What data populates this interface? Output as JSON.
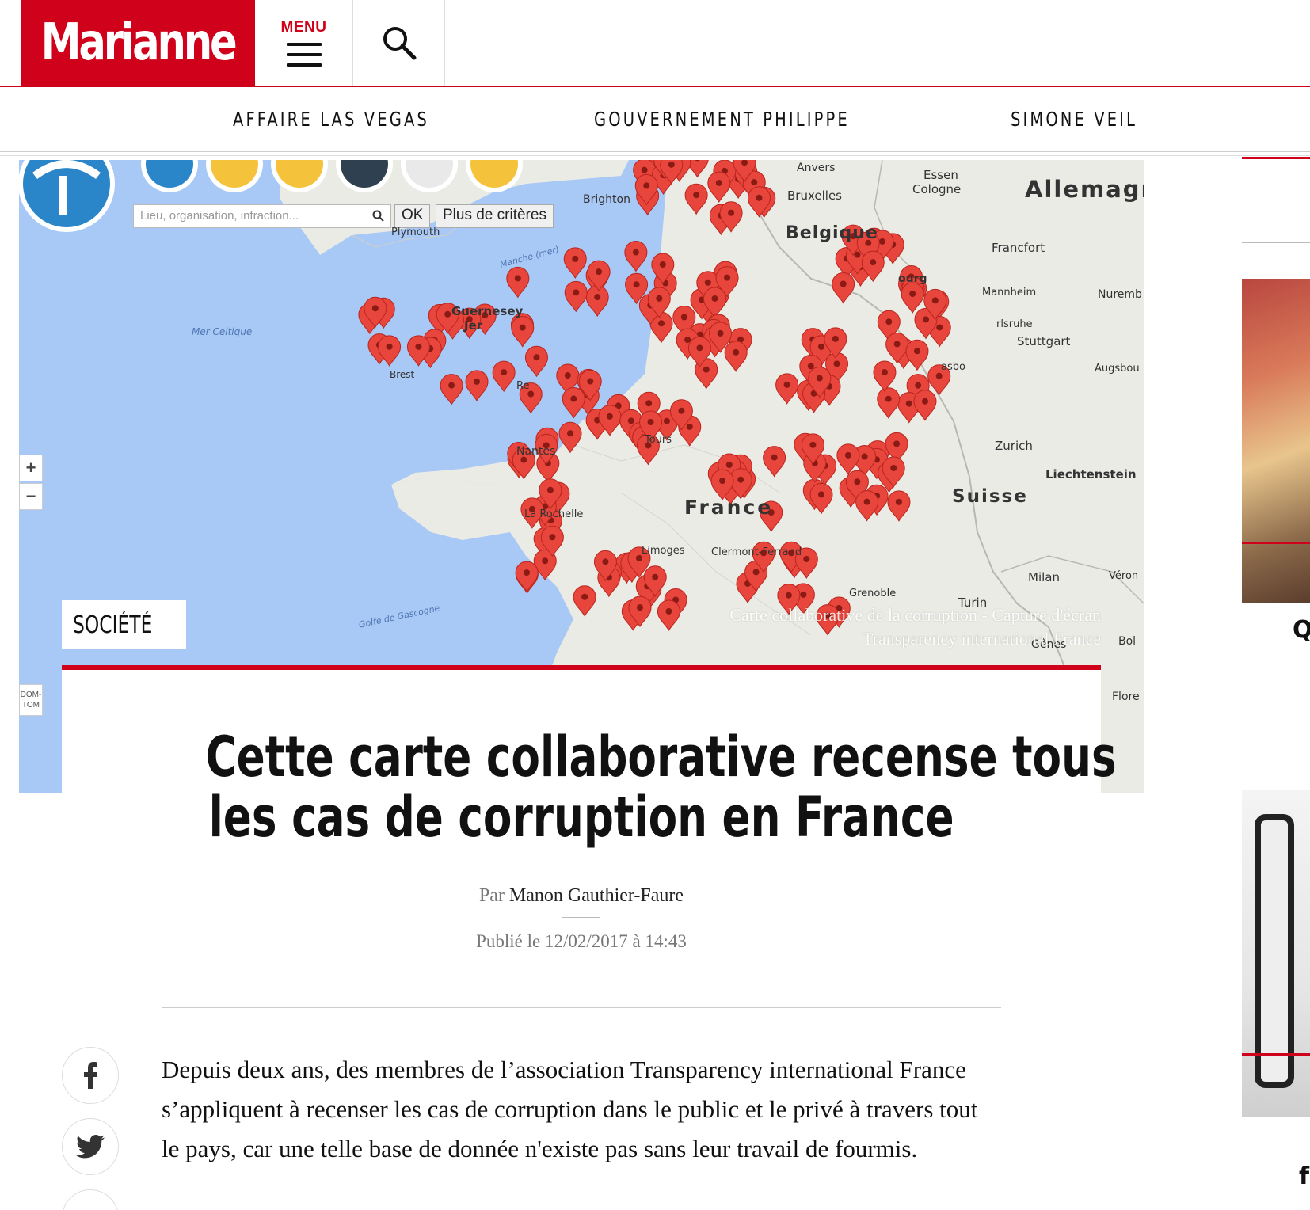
{
  "header": {
    "logo": "Marianne",
    "menu_label": "MENU"
  },
  "nav": {
    "items": [
      "AFFAIRE LAS VEGAS",
      "GOUVERNEMENT PHILIPPE",
      "SIMONE VEIL"
    ]
  },
  "map": {
    "search_placeholder": "Lieu, organisation, infraction...",
    "ok_label": "OK",
    "criteria_label": "Plus de critères",
    "zoom_in": "+",
    "zoom_out": "−",
    "domtom": "DOM-TOM",
    "labels": {
      "allemagne": "Allemagne",
      "belgique": "Belgique",
      "suisse": "Suisse",
      "france": "France",
      "liechtenstein": "Liechtenstein",
      "guernesey": "Guernesey",
      "brighton": "Brighton",
      "plymouth": "Plymouth",
      "bruxelles": "Bruxelles",
      "anvers": "Anvers",
      "essen": "Essen",
      "cologne": "Cologne",
      "francfort": "Francfort",
      "mannheim": "Mannheim",
      "nuremberg": "Nuremb",
      "stuttgart": "Stuttgart",
      "karlsruhe": "rlsruhe",
      "augsbourg": "Augsbou",
      "zurich": "Zurich",
      "milan": "Milan",
      "turin": "Turin",
      "verone": "Véron",
      "bologne": "Bol",
      "florence": "Flore",
      "genes": "Gênes",
      "brest": "Brest",
      "nantes": "Nantes",
      "tours": "Tours",
      "larochelle": "La Rochelle",
      "limoges": "Limoges",
      "clermont": "Clermont-Ferrand",
      "grenoble": "Grenoble",
      "rennes": "Re",
      "strasbourg": "asbo",
      "luxembourg": "ourg",
      "mer_celtique": "Mer Celtique",
      "manche": "Manche (mer)",
      "gascogne": "Golfe de Gascogne",
      "jersey": "Jer"
    },
    "caption_line1": "Carte collaborative de la corruption - Capture d'écran",
    "caption_line2": "Transparency international France"
  },
  "article": {
    "category": "SOCIÉTÉ",
    "headline_line1": "Cette carte collaborative recense tous",
    "headline_line2": "les cas de corruption en France",
    "by_prefix": "Par",
    "author": "Manon Gauthier-Faure",
    "published": "Publié le 12/02/2017 à 14:43",
    "body": "Depuis deux ans, des membres de l’association Transparency international France s’appliquent à recenser les cas de corruption dans le public et le privé à travers tout le pays, car une telle base de donnée n'existe pas sans leur travail de fourmis."
  },
  "sidebar": {
    "snippet1": "Qu",
    "snippet2": "f"
  },
  "colors": {
    "brand_red": "#d0021b",
    "sea": "#a8c8f5",
    "land": "#ebebe6",
    "marker": "#e8453c"
  },
  "icons": [
    "search-icon",
    "facebook-icon",
    "twitter-icon",
    "map-pin-icon",
    "menu-icon"
  ]
}
